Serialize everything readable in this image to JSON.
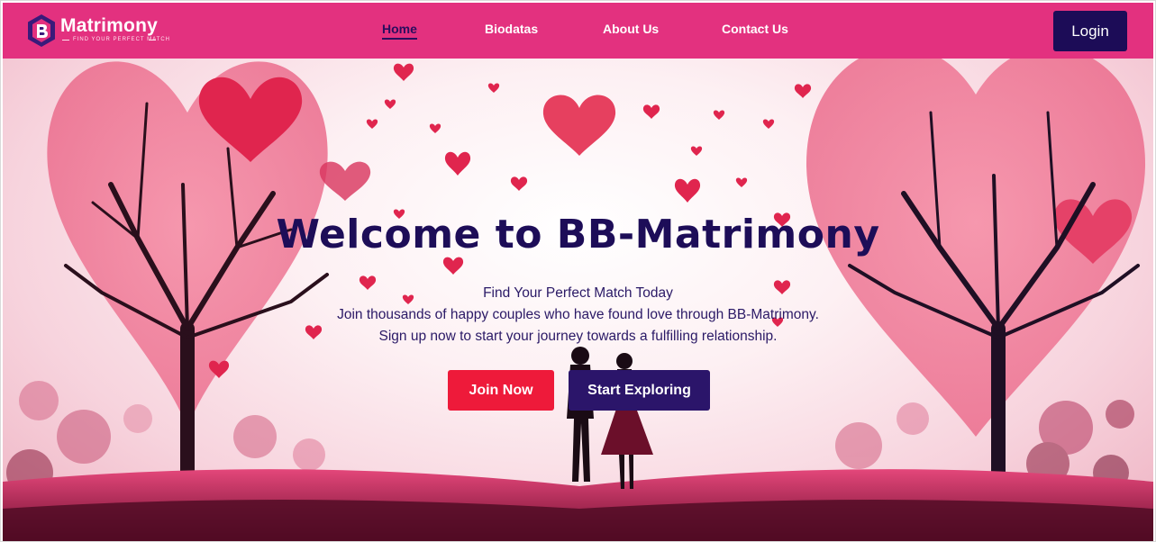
{
  "brand": {
    "name": "Matrimony",
    "tagline": "FIND YOUR PERFECT MATCH"
  },
  "nav": {
    "links": [
      {
        "label": "Home",
        "active": true
      },
      {
        "label": "Biodatas",
        "active": false
      },
      {
        "label": "About Us",
        "active": false
      },
      {
        "label": "Contact Us",
        "active": false
      }
    ],
    "login_label": "Login"
  },
  "hero": {
    "title": "Welcome to BB-Matrimony",
    "lines": [
      "Find Your Perfect Match Today",
      "Join thousands of happy couples who have found love through BB-Matrimony.",
      "Sign up now to start your journey towards a fulfilling relationship."
    ],
    "join_label": "Join Now",
    "explore_label": "Start Exploring"
  },
  "colors": {
    "navbar": "#e3317f",
    "primary_dark": "#1c0c57",
    "join": "#ee1a3a",
    "explore": "#2b156a"
  }
}
